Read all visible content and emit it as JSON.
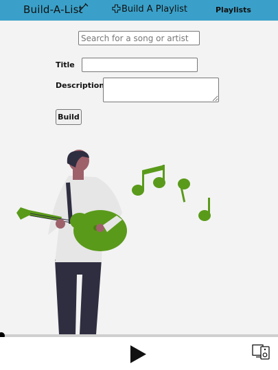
{
  "nav": {
    "brand": "Build-A-List",
    "build_link": "Build A Playlist",
    "playlists_link": "Playlists"
  },
  "search": {
    "placeholder": "Search for a song or artist",
    "value": ""
  },
  "form": {
    "title_label": "Title",
    "title_value": "",
    "description_label": "Description",
    "description_value": "",
    "build_label": "Build"
  },
  "player": {
    "progress": 0,
    "play_icon": "play-icon",
    "device_icon": "connect-device-icon"
  },
  "colors": {
    "navbar": "#3aa0c9",
    "accent_green": "#5a9a1a",
    "background": "#f3f3f3"
  }
}
